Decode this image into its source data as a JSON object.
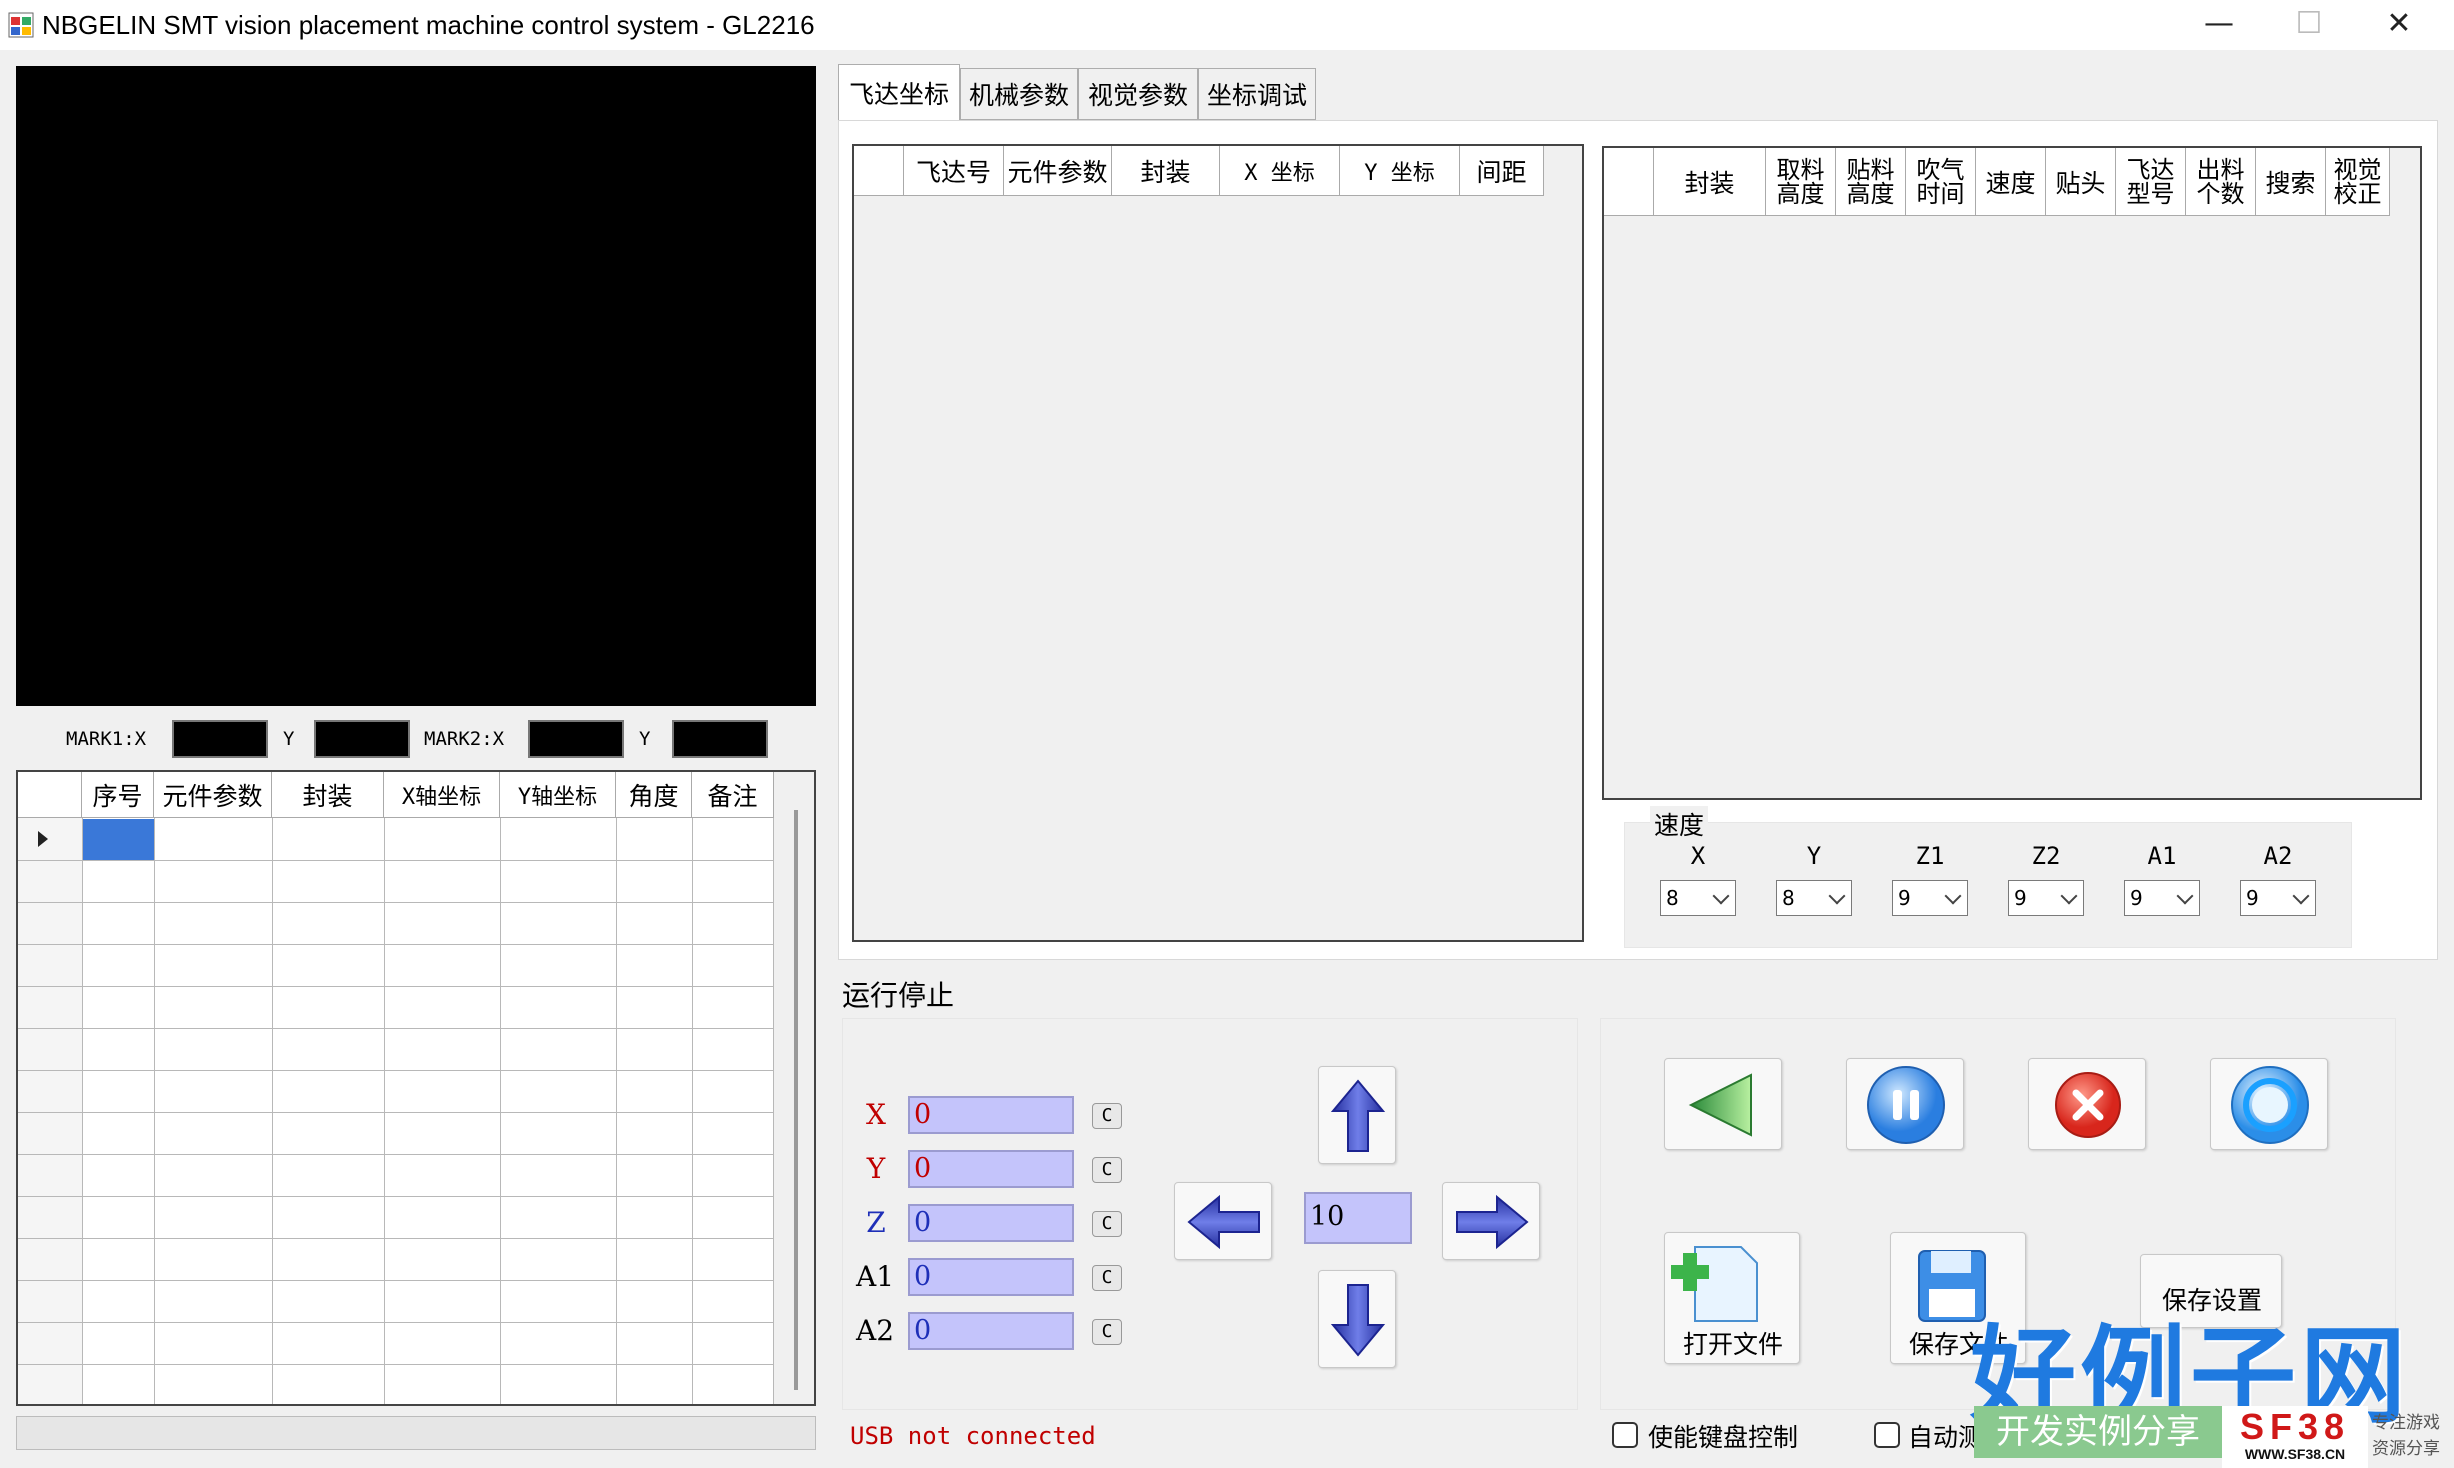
{
  "window": {
    "title": "NBGELIN SMT vision placement machine control system - GL2216",
    "minimize_glyph": "—",
    "maximize_glyph": "☐",
    "close_glyph": "✕"
  },
  "marks": {
    "mark1_x_label": "MARK1:X",
    "mark1_y_label": "Y",
    "mark2_x_label": "MARK2:X",
    "mark2_y_label": "Y"
  },
  "placement_table": {
    "columns": [
      "序号",
      "元件参数",
      "封装",
      "X轴坐标",
      "Y轴坐标",
      "角度",
      "备注"
    ]
  },
  "tabs": [
    "飞达坐标",
    "机械参数",
    "视觉参数",
    "坐标调试"
  ],
  "feeder_table": {
    "columns": [
      "飞达号",
      "元件参数",
      "封装",
      "X 坐标",
      "Y 坐标",
      "间距"
    ]
  },
  "param_table": {
    "columns": [
      "封装",
      "取料\n高度",
      "贴料\n高度",
      "吹气\n时间",
      "速度",
      "贴头",
      "飞达\n型号",
      "出料\n个数",
      "搜索",
      "视觉\n校正"
    ]
  },
  "speed": {
    "label": "速度",
    "axes": [
      {
        "name": "X",
        "value": "8"
      },
      {
        "name": "Y",
        "value": "8"
      },
      {
        "name": "Z1",
        "value": "9"
      },
      {
        "name": "Z2",
        "value": "9"
      },
      {
        "name": "A1",
        "value": "9"
      },
      {
        "name": "A2",
        "value": "9"
      }
    ]
  },
  "run": {
    "label": "运行停止",
    "axes": [
      {
        "name": "X",
        "value": "0",
        "color": "#c00000",
        "clear": "C"
      },
      {
        "name": "Y",
        "value": "0",
        "color": "#c00000",
        "clear": "C"
      },
      {
        "name": "Z",
        "value": "0",
        "color": "#1e2fb8",
        "clear": "C"
      },
      {
        "name": "A1",
        "value": "0",
        "color": "#000000",
        "clear": "C"
      },
      {
        "name": "A2",
        "value": "0",
        "color": "#000000",
        "clear": "C"
      }
    ],
    "step_value": "10",
    "status": "USB not connected",
    "status_color": "#c00000"
  },
  "actions": {
    "open_file": "打开文件",
    "save_file": "保存文件",
    "save_settings": "保存设置",
    "keyboard_control": "使能键盘控制",
    "auto_label": "自动测"
  },
  "watermark": {
    "main": "好例子网",
    "sub": "开发实例分享",
    "logo": "SF38",
    "logo_url": "WWW.SF38.CN",
    "side1": "专注游戏",
    "side2": "资源分享"
  },
  "colors": {
    "accent_select": "#3a78d8",
    "input_fill": "#c4c4fb",
    "arrow_blue": "#2f3fb8"
  }
}
